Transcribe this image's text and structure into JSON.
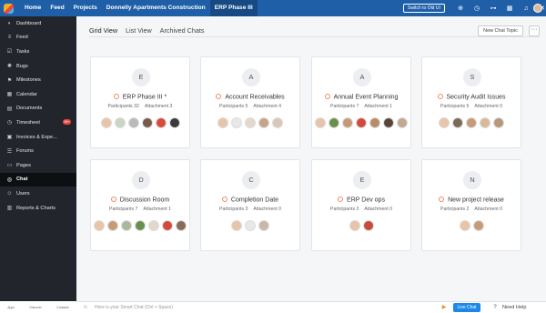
{
  "topbar": {
    "nav": [
      "Home",
      "Feed",
      "Projects",
      "Donnelly Apartments Construction",
      "ERP Phase III"
    ],
    "switch_label": "Switch to Old UI",
    "icons": [
      "add-icon",
      "timer-icon",
      "gamepad-icon",
      "calendar-icon",
      "bell-icon",
      "tools-icon"
    ]
  },
  "sidebar": {
    "items": [
      {
        "label": "Dashboard",
        "icon": "dashboard-icon"
      },
      {
        "label": "Feed",
        "icon": "feed-icon"
      },
      {
        "label": "Tasks",
        "icon": "tasks-icon"
      },
      {
        "label": "Bugs",
        "icon": "bug-icon"
      },
      {
        "label": "Milestones",
        "icon": "milestone-icon"
      },
      {
        "label": "Calendar",
        "icon": "calendar-icon"
      },
      {
        "label": "Documents",
        "icon": "document-icon"
      },
      {
        "label": "Timesheet",
        "icon": "timesheet-icon",
        "badge": "99+"
      },
      {
        "label": "Invoices & Expe...",
        "icon": "invoice-icon"
      },
      {
        "label": "Forums",
        "icon": "forum-icon"
      },
      {
        "label": "Pages",
        "icon": "page-icon"
      },
      {
        "label": "Chat",
        "icon": "chat-icon",
        "active": true
      },
      {
        "label": "Users",
        "icon": "users-icon"
      },
      {
        "label": "Reports & Charts",
        "icon": "reports-icon"
      }
    ]
  },
  "tabs": [
    "Grid View",
    "List View",
    "Archived Chats"
  ],
  "new_topic_label": "New Chat Topic",
  "more_label": "···",
  "cards": [
    {
      "letter": "E",
      "title": "ERP Phase III *",
      "participants": "Participants 32",
      "attachments": "Attachment 3",
      "avatars": [
        "#e8c4a8",
        "#c9d6c2",
        "#b9b9b9",
        "#7a5a48",
        "#d84a3a",
        "#3a3a3a"
      ]
    },
    {
      "letter": "A",
      "title": "Account Receivables",
      "participants": "Participants 5",
      "attachments": "Attachment 4",
      "avatars": [
        "#e8c4a8",
        "#e8e8e8",
        "#e5d7c9",
        "#c7a487",
        "#d8c8b8"
      ]
    },
    {
      "letter": "A",
      "title": "Annual Event Planning",
      "participants": "Participants 7",
      "attachments": "Attachment 1",
      "avatars": [
        "#e8c4a8",
        "#6a8f4a",
        "#c69a78",
        "#d24a3a",
        "#b88a68",
        "#5a4638",
        "#c4a890"
      ]
    },
    {
      "letter": "S",
      "title": "Security Audit Issues",
      "participants": "Participants 5",
      "attachments": "Attachment 0",
      "avatars": [
        "#e8c4a8",
        "#7a6a58",
        "#c89a7a",
        "#d8b898",
        "#b8987a"
      ]
    },
    {
      "letter": "D",
      "title": "Discussion Room",
      "participants": "Participants 7",
      "attachments": "Attachment 1",
      "avatars": [
        "#e8c4a8",
        "#c89a78",
        "#a8b89a",
        "#6a8f4a",
        "#e5d7c9",
        "#d24a3a",
        "#8a6a58"
      ]
    },
    {
      "letter": "C",
      "title": "Completion Date",
      "participants": "Participants 3",
      "attachments": "Attachment 0",
      "avatars": [
        "#e8c4a8",
        "#e8e8e8",
        "#c8b8a8"
      ]
    },
    {
      "letter": "E",
      "title": "ERP Dev ops",
      "participants": "Participants 2",
      "attachments": "Attachment 0",
      "avatars": [
        "#e8c4a8",
        "#c84a3a"
      ]
    },
    {
      "letter": "N",
      "title": "New project release",
      "participants": "Participants 2",
      "attachments": "Attachment 0",
      "avatars": [
        "#e8c4a8",
        "#c89a78"
      ]
    }
  ],
  "footer": {
    "left_labels": [
      "Apps",
      "Discover",
      "Contacts"
    ],
    "smart_chat_placeholder": "Here is your Smart Chat (Ctrl + Space)",
    "live_chat_label": "Live Chat",
    "need_help_label": "Need Help"
  }
}
